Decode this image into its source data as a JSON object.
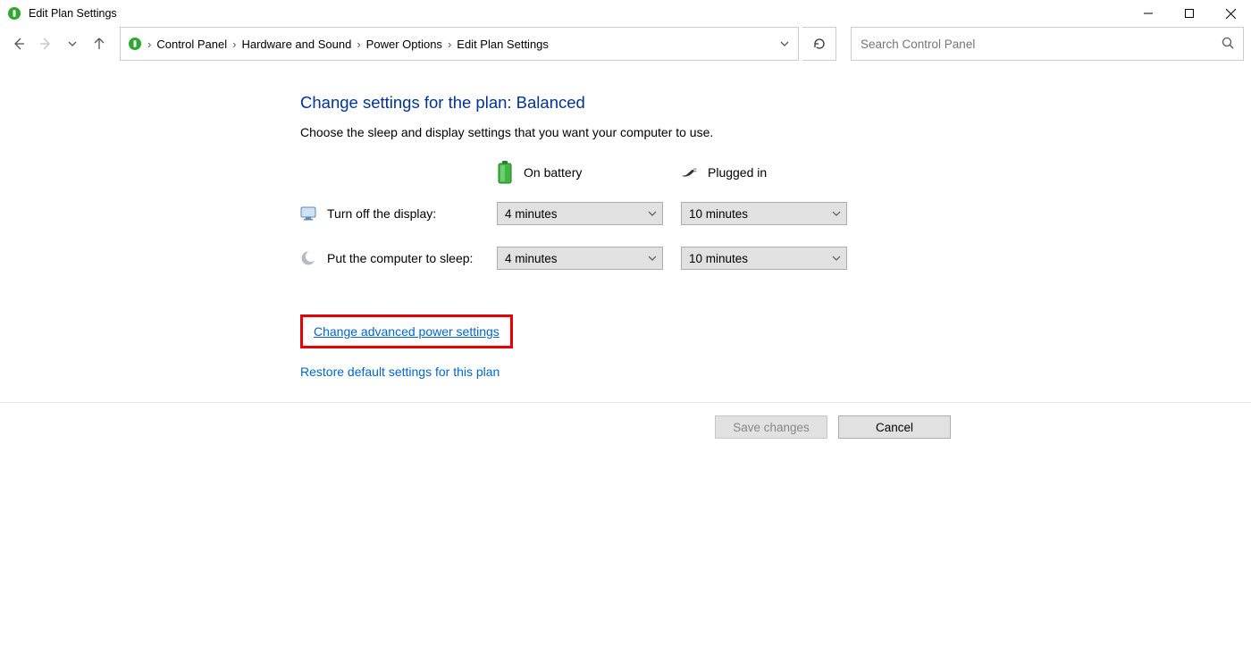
{
  "window": {
    "title": "Edit Plan Settings"
  },
  "breadcrumb": {
    "items": [
      "Control Panel",
      "Hardware and Sound",
      "Power Options",
      "Edit Plan Settings"
    ]
  },
  "search": {
    "placeholder": "Search Control Panel"
  },
  "page": {
    "heading": "Change settings for the plan: Balanced",
    "subtitle": "Choose the sleep and display settings that you want your computer to use."
  },
  "columns": {
    "battery": "On battery",
    "plugged": "Plugged in"
  },
  "rows": {
    "display": {
      "label": "Turn off the display:",
      "battery": "4 minutes",
      "plugged": "10 minutes"
    },
    "sleep": {
      "label": "Put the computer to sleep:",
      "battery": "4 minutes",
      "plugged": "10 minutes"
    }
  },
  "links": {
    "advanced": "Change advanced power settings",
    "restore": "Restore default settings for this plan"
  },
  "buttons": {
    "save": "Save changes",
    "cancel": "Cancel"
  }
}
